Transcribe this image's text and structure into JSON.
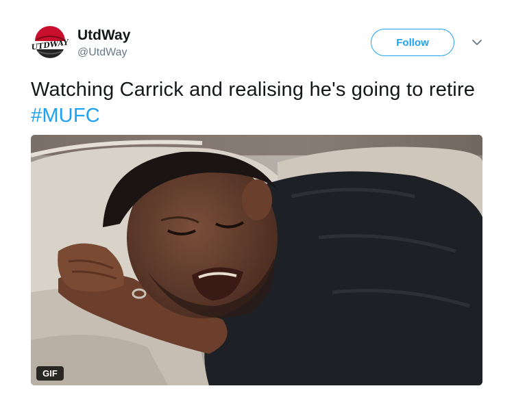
{
  "tweet": {
    "author": {
      "name": "UtdWay",
      "handle": "@UtdWay",
      "avatar_logo_text": "UTDWAY"
    },
    "follow_label": "Follow",
    "text_main": "Watching Carrick and realising he's going to retire ",
    "hashtag": "#MUFC",
    "media": {
      "badge": "GIF"
    }
  },
  "colors": {
    "accent": "#1da1f2",
    "text": "#14171a",
    "secondary": "#657786",
    "logo_red": "#c8102e"
  },
  "icons": {
    "menu": "chevron-down-icon"
  }
}
